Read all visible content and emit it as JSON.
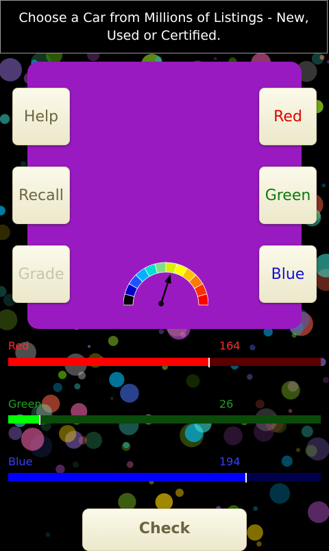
{
  "ad": {
    "text": "Choose a Car from Millions of Listings - New, Used or Certified."
  },
  "swatch": {
    "color": "#9a1ac2"
  },
  "buttons": {
    "help": "Help",
    "recall": "Recall",
    "grade": "Grade",
    "red": "Red",
    "green": "Green",
    "blue": "Blue",
    "check": "Check"
  },
  "button_colors": {
    "red": "#e00000",
    "green": "#0b7a0b",
    "blue": "#1010d0"
  },
  "gauge": {
    "needle_level": 0.6
  },
  "sliders": [
    {
      "label": "Red",
      "value": "164",
      "level": 164,
      "max": 255,
      "label_color": "#ff2a2a",
      "fill_color": "#ff0000",
      "track_color": "#5a0000"
    },
    {
      "label": "Green",
      "value": "26",
      "level": 26,
      "max": 255,
      "label_color": "#1fa01f",
      "fill_color": "#00ff00",
      "track_color": "#0a4a0a"
    },
    {
      "label": "Blue",
      "value": "194",
      "level": 194,
      "max": 255,
      "label_color": "#3c3cff",
      "fill_color": "#0000ff",
      "track_color": "#00004a"
    }
  ]
}
